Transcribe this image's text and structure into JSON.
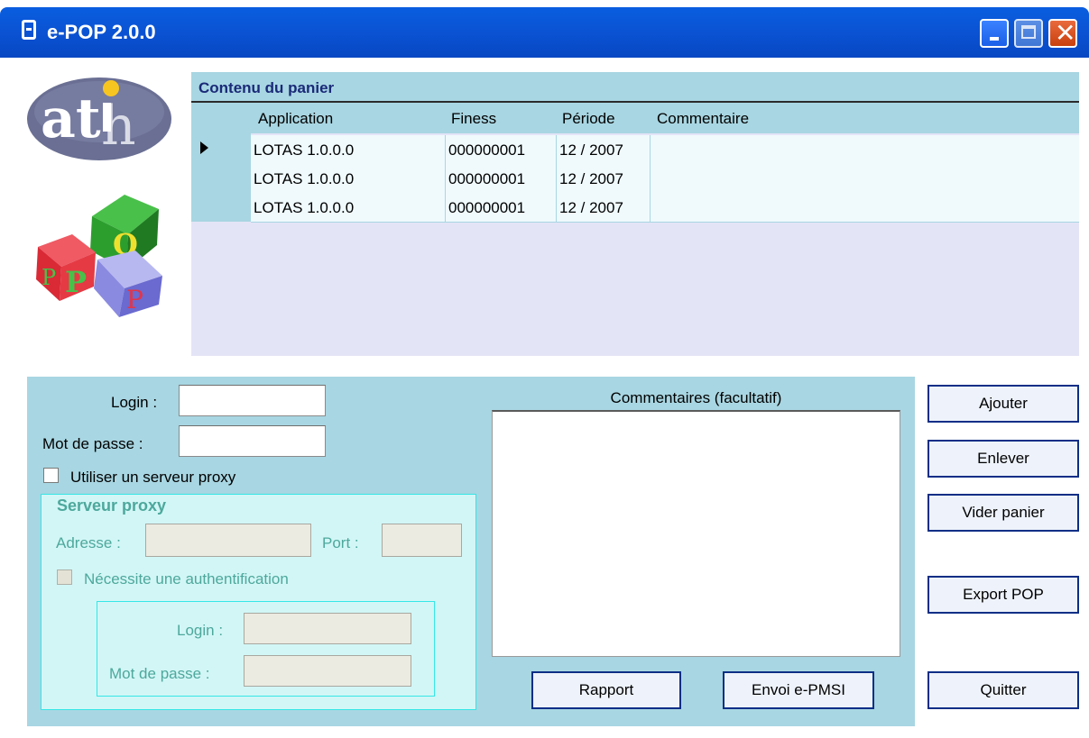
{
  "window": {
    "title": "e-POP 2.0.0"
  },
  "cart": {
    "title": "Contenu du panier",
    "columns": [
      "Application",
      "Finess",
      "Période",
      "Commentaire"
    ],
    "rows": [
      {
        "application": "LOTAS 1.0.0.0",
        "finess": "000000001",
        "periode": "12 / 2007",
        "commentaire": ""
      },
      {
        "application": "LOTAS 1.0.0.0",
        "finess": "000000001",
        "periode": "12 / 2007",
        "commentaire": ""
      },
      {
        "application": "LOTAS 1.0.0.0",
        "finess": "000000001",
        "periode": "12 / 2007",
        "commentaire": ""
      }
    ]
  },
  "login": {
    "login_label": "Login :",
    "login_value": "",
    "password_label": "Mot de passe :",
    "password_value": "",
    "proxy_checkbox_label": "Utiliser un serveur proxy",
    "proxy_checkbox_checked": false
  },
  "proxy": {
    "legend": "Serveur proxy",
    "address_label": "Adresse :",
    "address_value": "",
    "port_label": "Port :",
    "port_value": "",
    "auth_checkbox_label": "Nécessite une authentification",
    "auth_login_label": "Login :",
    "auth_login_value": "",
    "auth_password_label": "Mot de passe :",
    "auth_password_value": ""
  },
  "comments": {
    "label": "Commentaires (facultatif)",
    "value": ""
  },
  "buttons": {
    "ajouter": "Ajouter",
    "enlever": "Enlever",
    "vider": "Vider panier",
    "export": "Export POP",
    "quitter": "Quitter",
    "rapport": "Rapport",
    "envoi": "Envoi e-PMSI"
  },
  "colors": {
    "titlebar": "#0a55d6",
    "panel": "#a8d6e2",
    "proxy_frame": "#35e6e6",
    "button_border": "#0c2e86",
    "disabled_label": "#4da89c"
  }
}
